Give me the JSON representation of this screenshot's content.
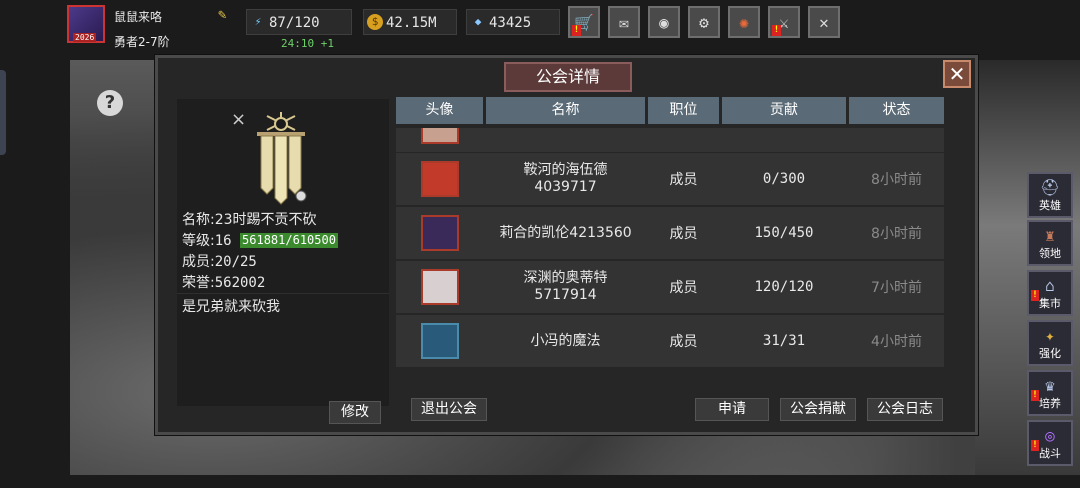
{
  "player": {
    "name": "鼠鼠来咯",
    "rank": "勇者2-7阶",
    "avatar_badge": "2026",
    "stamina": "87/120",
    "stamina_timer": "24:10 +1",
    "gold": "42.15M",
    "gems": "43425"
  },
  "toolbar": {
    "icons": [
      "shop-icon",
      "mail-icon",
      "gamepad-icon",
      "gear-icon",
      "color-wheel-icon",
      "sword-icon",
      "swords-crossed-icon"
    ]
  },
  "side_menu": {
    "items": [
      {
        "label": "英雄",
        "icon": "helmet-icon"
      },
      {
        "label": "领地",
        "icon": "castle-icon"
      },
      {
        "label": "集市",
        "icon": "market-icon"
      },
      {
        "label": "强化",
        "icon": "crystal-icon"
      },
      {
        "label": "培养",
        "icon": "trophy-icon"
      },
      {
        "label": "战斗",
        "icon": "portal-icon"
      }
    ]
  },
  "panel": {
    "title": "公会详情",
    "close": "✕"
  },
  "guild": {
    "name_label": "名称:",
    "name": "23时踢不贡不砍",
    "level_label": "等级:",
    "level": "16",
    "xp": "561881/610500",
    "members_label": "成员:",
    "members": "20/25",
    "honor_label": "荣誉:",
    "honor": "562002",
    "motto": "是兄弟就来砍我"
  },
  "buttons": {
    "edit": "修改",
    "leave": "退出公会",
    "apply": "申请",
    "donate": "公会捐献",
    "log": "公会日志"
  },
  "table": {
    "headers": [
      "头像",
      "名称",
      "职位",
      "贡献",
      "状态"
    ],
    "rows": [
      {
        "name_line1": "鞍河的海伍德",
        "name_line2": "4039717",
        "position": "成员",
        "contribution": "0/300",
        "status": "8小时前",
        "portrait_color": "#c23a2a"
      },
      {
        "name_line1": "莉合的凯伦4213560",
        "name_line2": "",
        "position": "成员",
        "contribution": "150/450",
        "status": "8小时前",
        "portrait_color": "#3a2a5a"
      },
      {
        "name_line1": "深渊的奥蒂特",
        "name_line2": "5717914",
        "position": "成员",
        "contribution": "120/120",
        "status": "7小时前",
        "portrait_color": "#d8d0d0"
      },
      {
        "name_line1": "小冯的魔法",
        "name_line2": "",
        "position": "成员",
        "contribution": "31/31",
        "status": "4小时前",
        "portrait_color": "#2a5a7a"
      }
    ]
  }
}
